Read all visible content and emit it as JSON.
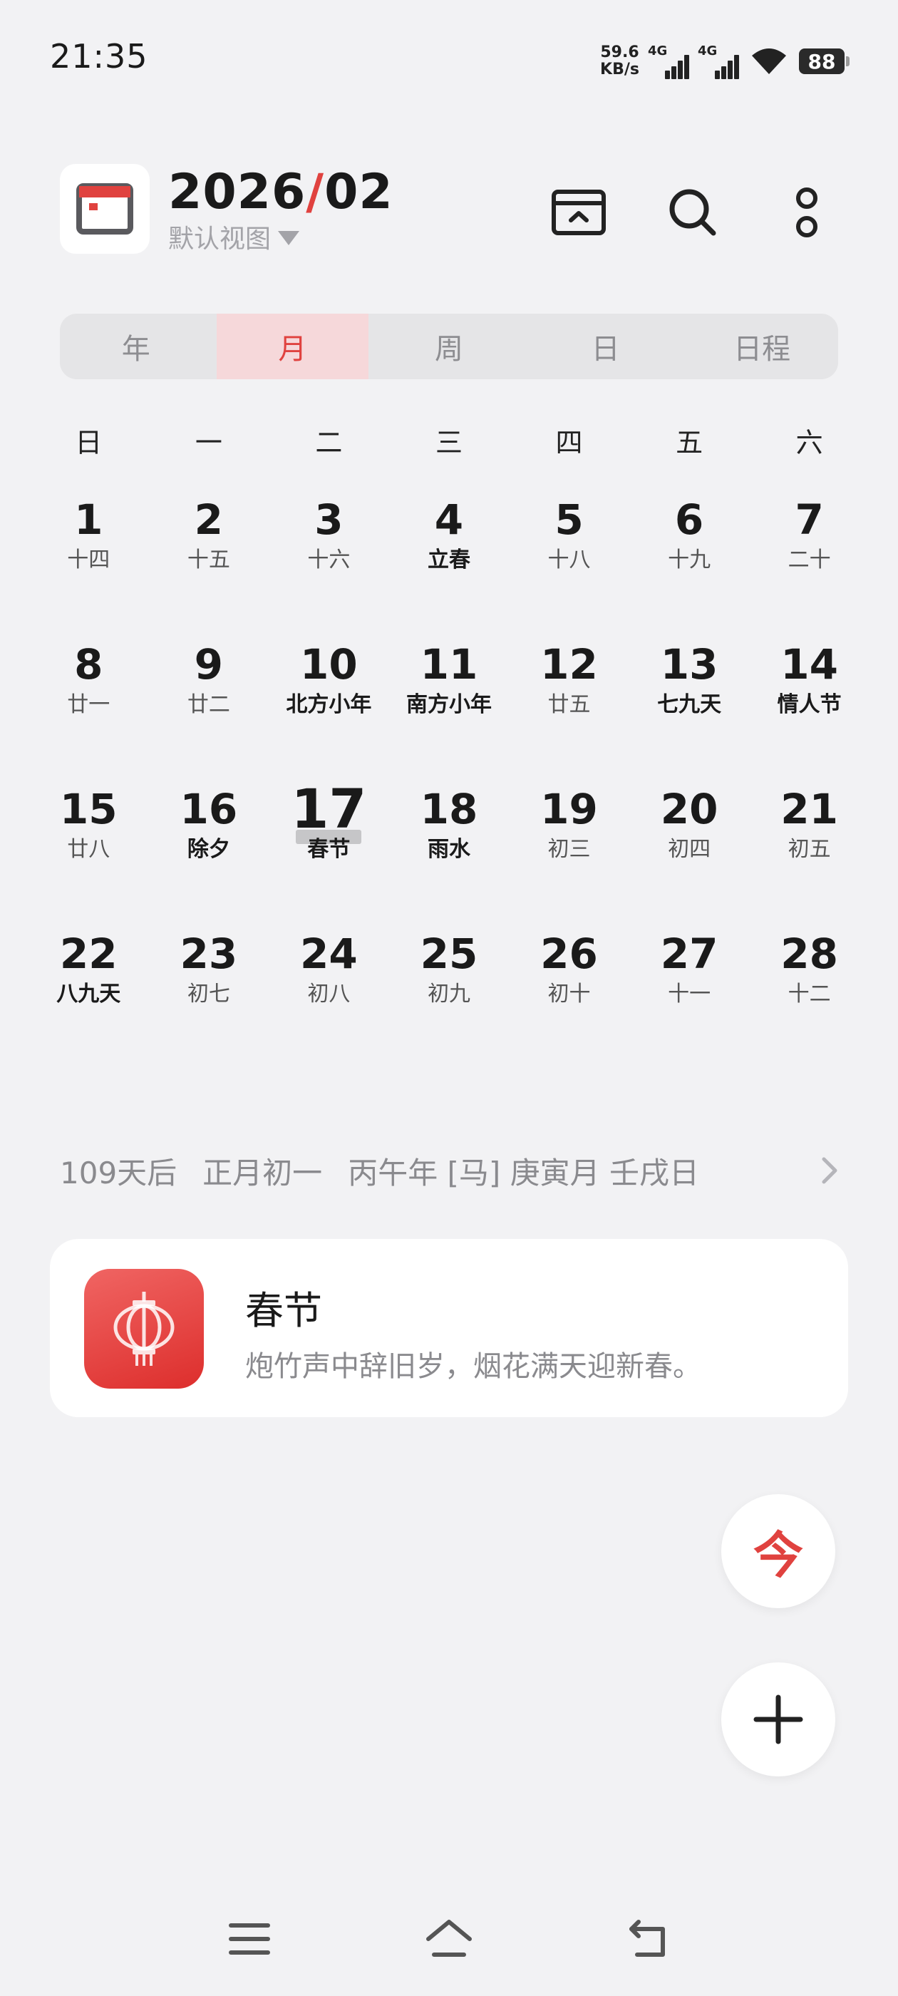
{
  "status_bar": {
    "time": "21:35",
    "net_speed_value": "59.6",
    "net_speed_unit": "KB/s",
    "sim1_label": "4G",
    "sim2_label": "4G",
    "battery": "88"
  },
  "header": {
    "year": "2026",
    "separator": "/",
    "month": "02",
    "view_name": "默认视图",
    "accent_color": "#e0423f",
    "actions": [
      "calendar-view-icon",
      "search-icon",
      "more-icon"
    ]
  },
  "view_tabs": [
    {
      "label": "年",
      "active": false
    },
    {
      "label": "月",
      "active": true
    },
    {
      "label": "周",
      "active": false
    },
    {
      "label": "日",
      "active": false
    },
    {
      "label": "日程",
      "active": false
    }
  ],
  "weekdays": [
    "日",
    "一",
    "二",
    "三",
    "四",
    "五",
    "六"
  ],
  "weeks": [
    [
      {
        "day": "1",
        "sub": "十四",
        "bold": false
      },
      {
        "day": "2",
        "sub": "十五",
        "bold": false
      },
      {
        "day": "3",
        "sub": "十六",
        "bold": false
      },
      {
        "day": "4",
        "sub": "立春",
        "bold": true
      },
      {
        "day": "5",
        "sub": "十八",
        "bold": false
      },
      {
        "day": "6",
        "sub": "十九",
        "bold": false
      },
      {
        "day": "7",
        "sub": "二十",
        "bold": false
      }
    ],
    [
      {
        "day": "8",
        "sub": "廿一",
        "bold": false
      },
      {
        "day": "9",
        "sub": "廿二",
        "bold": false
      },
      {
        "day": "10",
        "sub": "北方小年",
        "bold": true
      },
      {
        "day": "11",
        "sub": "南方小年",
        "bold": true
      },
      {
        "day": "12",
        "sub": "廿五",
        "bold": false
      },
      {
        "day": "13",
        "sub": "七九天",
        "bold": true
      },
      {
        "day": "14",
        "sub": "情人节",
        "bold": true
      }
    ],
    [
      {
        "day": "15",
        "sub": "廿八",
        "bold": false
      },
      {
        "day": "16",
        "sub": "除夕",
        "bold": true
      },
      {
        "day": "17",
        "sub": "春节",
        "bold": true,
        "today": true
      },
      {
        "day": "18",
        "sub": "雨水",
        "bold": true
      },
      {
        "day": "19",
        "sub": "初三",
        "bold": false
      },
      {
        "day": "20",
        "sub": "初四",
        "bold": false
      },
      {
        "day": "21",
        "sub": "初五",
        "bold": false
      }
    ],
    [
      {
        "day": "22",
        "sub": "八九天",
        "bold": true
      },
      {
        "day": "23",
        "sub": "初七",
        "bold": false
      },
      {
        "day": "24",
        "sub": "初八",
        "bold": false
      },
      {
        "day": "25",
        "sub": "初九",
        "bold": false
      },
      {
        "day": "26",
        "sub": "初十",
        "bold": false
      },
      {
        "day": "27",
        "sub": "十一",
        "bold": false
      },
      {
        "day": "28",
        "sub": "十二",
        "bold": false
      }
    ]
  ],
  "info_line": {
    "countdown": "109天后",
    "lunar_date": "正月初一",
    "ganzhi": "丙午年 [马] 庚寅月 壬戌日"
  },
  "event": {
    "title": "春节",
    "description": "炮竹声中辞旧岁，烟花满天迎新春。",
    "icon": "lantern-icon"
  },
  "fab": {
    "today_label": "今"
  }
}
